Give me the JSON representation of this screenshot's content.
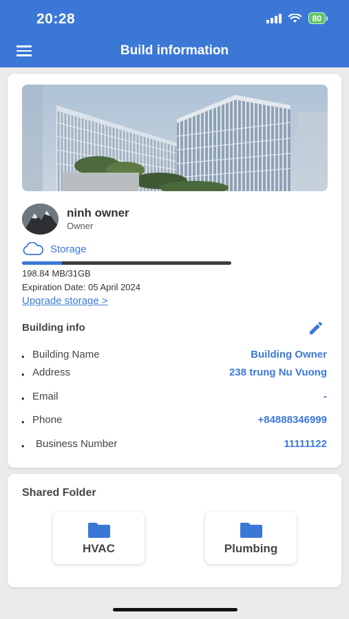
{
  "status_bar": {
    "time": "20:28",
    "battery": "80"
  },
  "header": {
    "title": "Build information"
  },
  "owner": {
    "name": "ninh owner",
    "role": "Owner"
  },
  "storage": {
    "label": "Storage",
    "used_text": "198.84 MB/31GB",
    "usage_fraction": 0.19,
    "expiration": "Expiration Date: 05 April 2024",
    "upgrade_link": "Upgrade storage >"
  },
  "building_info": {
    "title": "Building info",
    "rows": [
      {
        "label": "Building Name",
        "value": "Building Owner"
      },
      {
        "label": "Address",
        "value": "238 trung Nu Vuong"
      },
      {
        "label": "Email",
        "value": "-"
      },
      {
        "label": "Phone",
        "value": "+84888346999"
      },
      {
        "label": "Business Number",
        "value": "11111122"
      }
    ]
  },
  "shared_folder": {
    "title": "Shared Folder",
    "folders": [
      {
        "label": "HVAC",
        "icon": "folder-icon"
      },
      {
        "label": "Plumbing",
        "icon": "folder-icon"
      }
    ]
  },
  "colors": {
    "accent": "#3b78d6",
    "battery": "#5ec564"
  }
}
